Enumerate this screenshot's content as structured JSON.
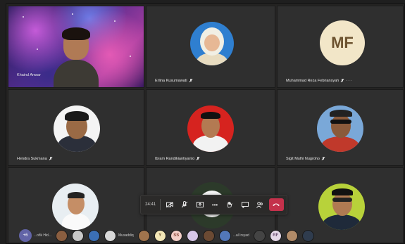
{
  "participants": [
    {
      "name": "Khairul Anwar"
    },
    {
      "name": "Erlina Kusumawati"
    },
    {
      "name": "Muhammad Reza Febriansyah",
      "initials": "MF"
    },
    {
      "name": "Hendra Sukmana"
    },
    {
      "name": "Ibram Randikiantiyanto"
    },
    {
      "name": "Sigit Mulhi Nugroho"
    },
    {
      "name": ""
    },
    {
      "name": ""
    },
    {
      "name": ""
    }
  ],
  "toolbar": {
    "timer": "24:41",
    "buttons": [
      "video-off-icon",
      "mic-off-icon",
      "share-icon",
      "more-icon",
      "raise-hand-icon",
      "chat-icon",
      "participants-icon",
      "hang-up-icon"
    ]
  },
  "strip": {
    "more_label": "+6",
    "labels": [
      "...ofik Hid...",
      "Musaddiq",
      "...al Irsyad"
    ],
    "initials": [
      "Y",
      "SS",
      "RF"
    ]
  },
  "colors": {
    "hangup": "#c4314b",
    "overflow": "#6264a7",
    "initials_avatar": "#f2e6c8"
  }
}
